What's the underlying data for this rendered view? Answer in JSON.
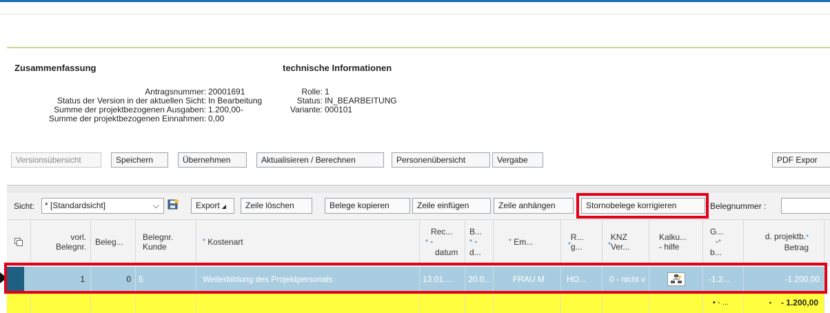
{
  "summary": {
    "title": "Zusammenfassung",
    "fields": [
      {
        "label": "Antragsnummer:",
        "value": "20001691"
      },
      {
        "label": "Status der Version in der aktuellen Sicht:",
        "value": "In Bearbeitung"
      },
      {
        "label": "Summe der projektbezogenen Ausgaben:",
        "value": "1.200,00-"
      },
      {
        "label": "Summe der projektbezogenen Einnahmen:",
        "value": "0,00"
      }
    ]
  },
  "tech": {
    "title": "technische Informationen",
    "fields": [
      {
        "label": "Rolle:",
        "value": "1"
      },
      {
        "label": "Status:",
        "value": "IN_BEARBEITUNG"
      },
      {
        "label": "Variante:",
        "value": "000101"
      }
    ]
  },
  "buttons": {
    "versions": "Versionsübersicht",
    "save": "Speichern",
    "apply": "Übernehmen",
    "refresh": "Aktualisieren / Berechnen",
    "persons": "Personenübersicht",
    "award": "Vergabe",
    "pdf": "PDF Expor"
  },
  "toolbar": {
    "view_label": "Sicht:",
    "view_value": "* [Standardsicht]",
    "export": "Export",
    "delete_row": "Zeile löschen",
    "copy_docs": "Belege kopieren",
    "insert_row": "Zeile einfügen",
    "append_row": "Zeile anhängen",
    "storno": "Stornobelege korrigieren",
    "docnum_label": "Belegnummer :"
  },
  "columns": {
    "c1a": "vorl.",
    "c1b": "Belegnr.",
    "c2": "Beleg...",
    "c3a": "Belegnr.",
    "c3b": "Kunde",
    "c4": "Kostenart",
    "c5a": "Rec...",
    "c5b": "-",
    "c5c": "datum",
    "c6a": "B...",
    "c6b": "-",
    "c6c": "d...",
    "c7": "Em...",
    "c8a": "R...",
    "c8b": "g...",
    "c9a": "KNZ",
    "c9b": "Ver...",
    "c10a": "Kalku...",
    "c10b": "- hilfe",
    "c11a": "G...",
    "c11b": "-",
    "c11c": "b...",
    "c12a": "d. projektb.",
    "c12b": "Betrag"
  },
  "row": {
    "vorl": "1",
    "beleg": "0",
    "kunde": "5",
    "kostenart": "Weiterbildung des Projektpersonals",
    "recdatum": "13.01....",
    "bd": "20.0...",
    "em": "FRAU M",
    "rg": "HO...",
    "knz": "0 - nicht v",
    "g": "-1.2...",
    "betrag": "-1.200,00"
  },
  "sum": {
    "g": "▪ - ...",
    "betrag": "- 1.200,00"
  }
}
